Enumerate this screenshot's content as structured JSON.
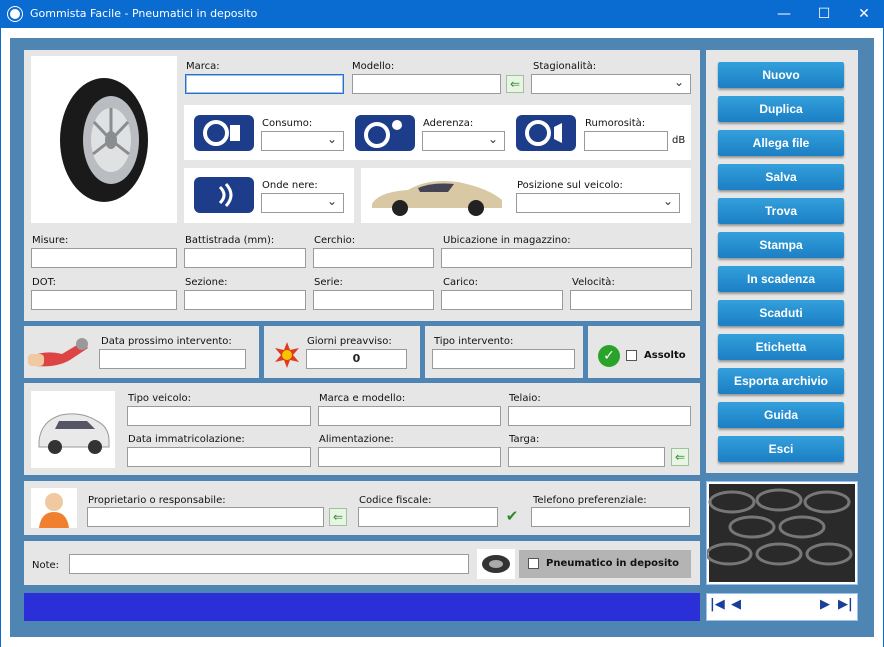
{
  "window": {
    "title": "Gommista Facile - Pneumatici in deposito",
    "minimize": "—",
    "maximize": "☐",
    "close": "✕"
  },
  "tire": {
    "marca": "Marca:",
    "modello": "Modello:",
    "stagionalita": "Stagionalità:",
    "consumo": "Consumo:",
    "aderenza": "Aderenza:",
    "rumorosita": "Rumorosità:",
    "db": "dB",
    "onde_nere": "Onde nere:",
    "posizione": "Posizione sul veicolo:",
    "misure": "Misure:",
    "battistrada": "Battistrada (mm):",
    "cerchio": "Cerchio:",
    "ubicazione": "Ubicazione in magazzino:",
    "dot": "DOT:",
    "sezione": "Sezione:",
    "serie": "Serie:",
    "carico": "Carico:",
    "velocita": "Velocità:"
  },
  "service": {
    "data_prossimo": "Data prossimo intervento:",
    "giorni_preavviso": "Giorni preavviso:",
    "giorni_value": "0",
    "tipo_intervento": "Tipo intervento:",
    "assolto": "Assolto"
  },
  "vehicle": {
    "tipo_veicolo": "Tipo veicolo:",
    "marca_modello": "Marca e modello:",
    "telaio": "Telaio:",
    "data_immatricolazione": "Data immatricolazione:",
    "alimentazione": "Alimentazione:",
    "targa": "Targa:"
  },
  "owner": {
    "proprietario": "Proprietario o responsabile:",
    "codice_fiscale": "Codice fiscale:",
    "telefono": "Telefono preferenziale:"
  },
  "notes": {
    "label": "Note:",
    "deposito": "Pneumatico in deposito"
  },
  "sidebar": [
    "Nuovo",
    "Duplica",
    "Allega file",
    "Salva",
    "Trova",
    "Stampa",
    "In scadenza",
    "Scaduti",
    "Etichetta",
    "Esporta archivio",
    "Guida",
    "Esci"
  ],
  "nav": {
    "first": "|◀",
    "prev": "◀",
    "next": "▶",
    "last": "▶|"
  },
  "colors": {
    "accent": "#0a6cd1",
    "button": "#1b7fc4",
    "status_bar": "#2b2fd8",
    "badge": "#1d3d8a"
  }
}
